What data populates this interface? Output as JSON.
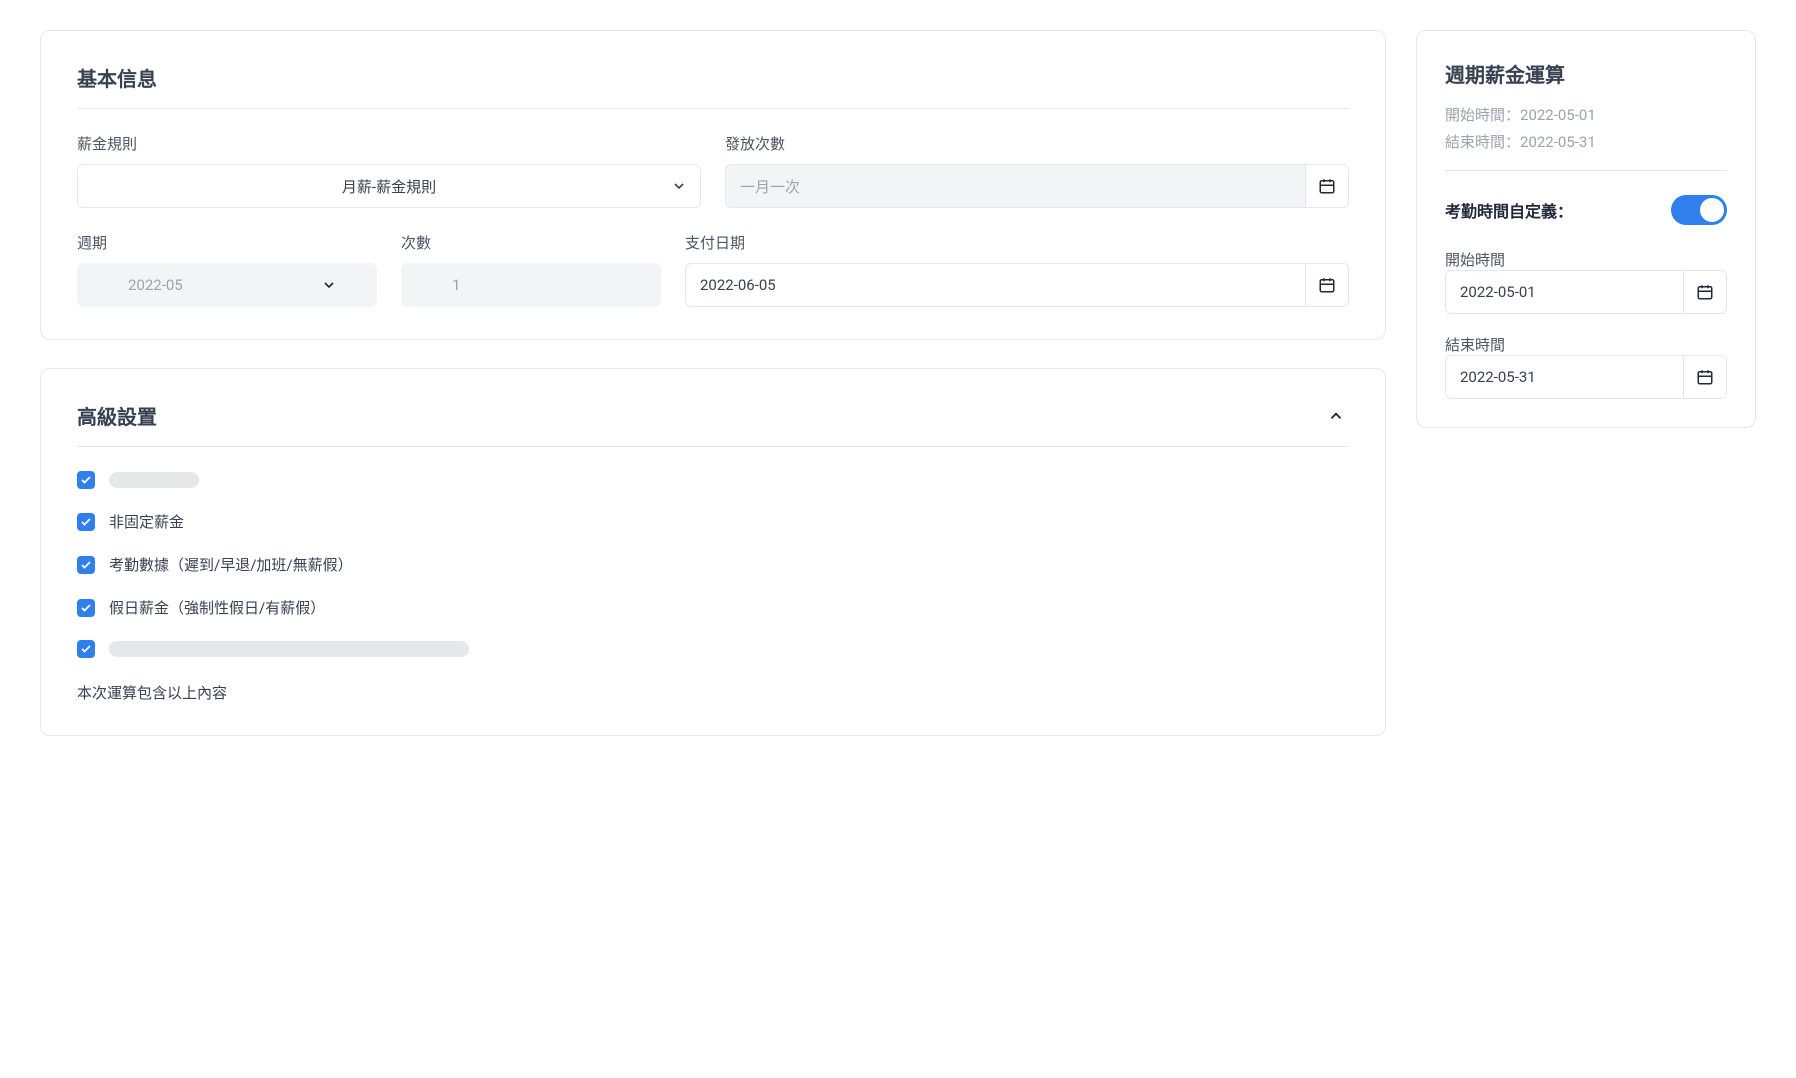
{
  "basic": {
    "title": "基本信息",
    "salary_rule_label": "薪金規則",
    "salary_rule_value": "月薪-薪金規則",
    "pay_times_label": "發放次數",
    "pay_times_placeholder": "一月一次",
    "period_label": "週期",
    "period_value": "2022-05",
    "count_label": "次數",
    "count_value": "1",
    "pay_date_label": "支付日期",
    "pay_date_value": "2022-06-05"
  },
  "advanced": {
    "title": "高級設置",
    "items": [
      {
        "label": ""
      },
      {
        "label": "非固定薪金"
      },
      {
        "label": "考勤數據（遲到/早退/加班/無薪假）"
      },
      {
        "label": "假日薪金（強制性假日/有薪假）"
      },
      {
        "label": ""
      }
    ],
    "footer": "本次運算包含以上內容"
  },
  "side": {
    "title": "週期薪金運算",
    "start_info_label": "開始時間：",
    "start_info_value": "2022-05-01",
    "end_info_label": "結束時間：",
    "end_info_value": "2022-05-31",
    "toggle_label": "考勤時間自定義：",
    "start_label": "開始時間",
    "start_value": "2022-05-01",
    "end_label": "結束時間",
    "end_value": "2022-05-31"
  }
}
